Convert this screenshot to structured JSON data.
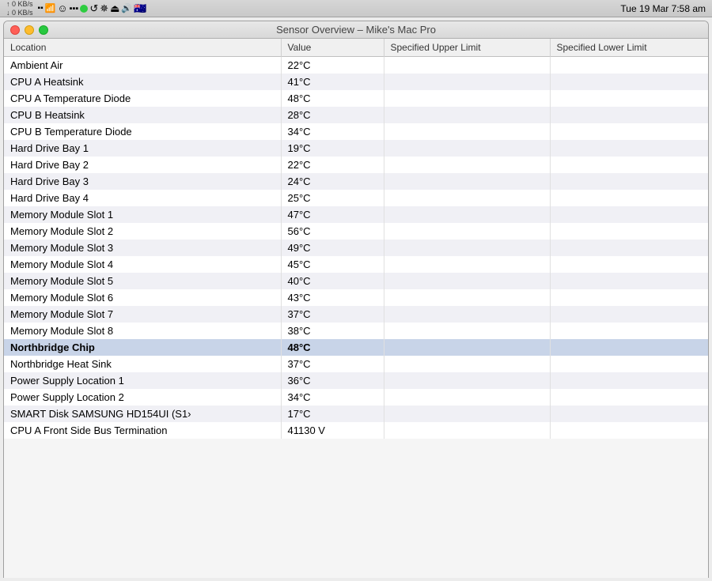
{
  "menubar": {
    "net_up": "0 KB/s",
    "net_down": "0 KB/s",
    "datetime": "Tue 19 Mar  7:58 am"
  },
  "window": {
    "title": "Sensor Overview – Mike's Mac Pro"
  },
  "table": {
    "headers": [
      "Location",
      "Value",
      "Specified Upper Limit",
      "Specified Lower Limit"
    ],
    "rows": [
      {
        "location": "Ambient Air",
        "value": "22°C",
        "upper": "",
        "lower": "",
        "highlight": false
      },
      {
        "location": "CPU A Heatsink",
        "value": "41°C",
        "upper": "",
        "lower": "",
        "highlight": false
      },
      {
        "location": "CPU A Temperature Diode",
        "value": "48°C",
        "upper": "",
        "lower": "",
        "highlight": false
      },
      {
        "location": "CPU B Heatsink",
        "value": "28°C",
        "upper": "",
        "lower": "",
        "highlight": false
      },
      {
        "location": "CPU B Temperature Diode",
        "value": "34°C",
        "upper": "",
        "lower": "",
        "highlight": false
      },
      {
        "location": "Hard Drive Bay 1",
        "value": "19°C",
        "upper": "",
        "lower": "",
        "highlight": false
      },
      {
        "location": "Hard Drive Bay 2",
        "value": "22°C",
        "upper": "",
        "lower": "",
        "highlight": false
      },
      {
        "location": "Hard Drive Bay 3",
        "value": "24°C",
        "upper": "",
        "lower": "",
        "highlight": false
      },
      {
        "location": "Hard Drive Bay 4",
        "value": "25°C",
        "upper": "",
        "lower": "",
        "highlight": false
      },
      {
        "location": "Memory Module Slot 1",
        "value": "47°C",
        "upper": "",
        "lower": "",
        "highlight": false
      },
      {
        "location": "Memory Module Slot 2",
        "value": "56°C",
        "upper": "",
        "lower": "",
        "highlight": false
      },
      {
        "location": "Memory Module Slot 3",
        "value": "49°C",
        "upper": "",
        "lower": "",
        "highlight": false
      },
      {
        "location": "Memory Module Slot 4",
        "value": "45°C",
        "upper": "",
        "lower": "",
        "highlight": false
      },
      {
        "location": "Memory Module Slot 5",
        "value": "40°C",
        "upper": "",
        "lower": "",
        "highlight": false
      },
      {
        "location": "Memory Module Slot 6",
        "value": "43°C",
        "upper": "",
        "lower": "",
        "highlight": false
      },
      {
        "location": "Memory Module Slot 7",
        "value": "37°C",
        "upper": "",
        "lower": "",
        "highlight": false
      },
      {
        "location": "Memory Module Slot 8",
        "value": "38°C",
        "upper": "",
        "lower": "",
        "highlight": false
      },
      {
        "location": "Northbridge Chip",
        "value": "48°C",
        "upper": "",
        "lower": "",
        "highlight": true
      },
      {
        "location": "Northbridge Heat Sink",
        "value": "37°C",
        "upper": "",
        "lower": "",
        "highlight": false
      },
      {
        "location": "Power Supply Location 1",
        "value": "36°C",
        "upper": "",
        "lower": "",
        "highlight": false
      },
      {
        "location": "Power Supply Location 2",
        "value": "34°C",
        "upper": "",
        "lower": "",
        "highlight": false
      },
      {
        "location": "SMART Disk SAMSUNG HD154UI (S1›",
        "value": "17°C",
        "upper": "",
        "lower": "",
        "highlight": false
      },
      {
        "location": "CPU A Front Side Bus Termination",
        "value": "41130 V",
        "upper": "",
        "lower": "",
        "highlight": false
      }
    ]
  }
}
